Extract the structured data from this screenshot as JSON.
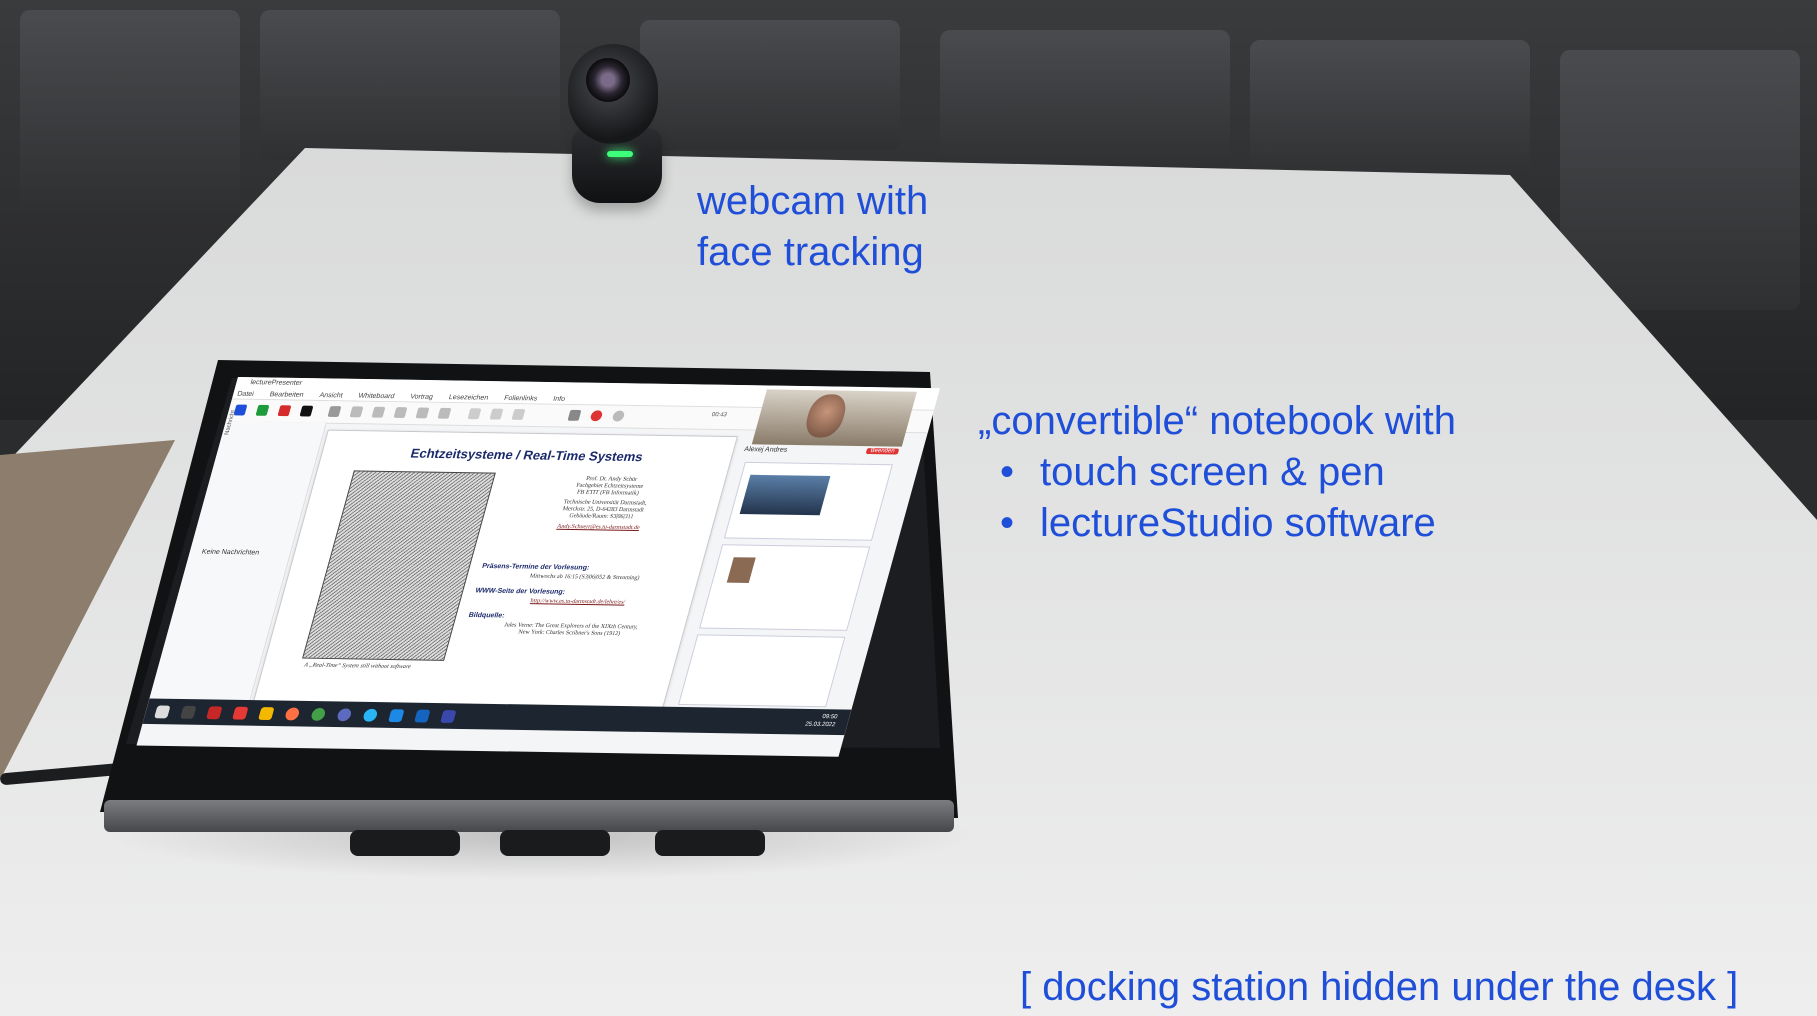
{
  "annotations": {
    "webcam": [
      "webcam with",
      "face tracking"
    ],
    "notebook_title": "„convertible“ notebook with",
    "notebook_bullets": [
      "touch screen & pen",
      "lectureStudio software"
    ],
    "bullet_symbol": "•",
    "docking": "[ docking station hidden under the desk ]"
  },
  "screen": {
    "app_title": "lecturePresenter",
    "menu": [
      "Datei",
      "Bearbeiten",
      "Ansicht",
      "Whiteboard",
      "Vortrag",
      "Lesezeichen",
      "Folienlinks",
      "Info"
    ],
    "sidebar_label": "Nachricht",
    "sidebar_empty": "Keine Nachrichten",
    "slide": {
      "title": "Echtzeitsysteme / Real-Time Systems",
      "author_lines": [
        "Prof. Dr. Andy Schür",
        "Fachgebiet Echtzeitsysteme",
        "FB ETIT (FB Informatik)"
      ],
      "address_lines": [
        "Technische Universität Darmstadt,",
        "Merckstr. 25, D-64283 Darmstadt",
        "Gebäude/Raum: S3|06|311"
      ],
      "email": "Andy.Schuerr@es.tu-darmstadt.de",
      "sections": [
        {
          "heading": "Präsens-Termine der Vorlesung:",
          "lines": [
            "Mittwochs ab 16:15 (S3|06|052 & Streaming)"
          ]
        },
        {
          "heading": "WWW-Seite der Vorlesung:",
          "lines": [
            "http://www.es.tu-darmstadt.de/lehre/es/"
          ]
        },
        {
          "heading": "Bildquelle:",
          "lines": [
            "Jules Verne: The Great Explorers of the XIXth Century,",
            "New York: Charles Scribner's Sons (1912)"
          ]
        }
      ],
      "caption": "A „Real-Time“ System still without software"
    },
    "participant_name": "Alexej Andres",
    "end_button": "Beenden",
    "clock_time": "09:50",
    "clock_date": "25.03.2022",
    "toolbar_time": "00:43"
  },
  "colors": {
    "annotation": "#1f4fd8",
    "desk": "#e3e4e4",
    "slide_title": "#1b2a6b",
    "taskbar": "#1d2530"
  }
}
